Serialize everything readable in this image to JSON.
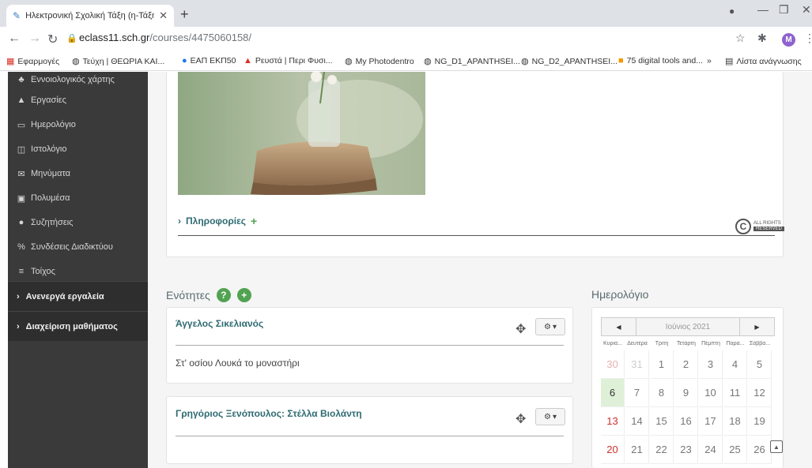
{
  "browser": {
    "tab_title": "Ηλεκτρονική Σχολική Τάξη (η-Τάξη)",
    "url_host": "eclass11.sch.gr",
    "url_path": "/courses/4475060158/",
    "avatar_letter": "M",
    "bookmarks": [
      {
        "label": "Εφαρμογές",
        "icon": "apps-grid-icon"
      },
      {
        "label": "Τεύχη | ΘΕΩΡΙΑ ΚΑΙ...",
        "icon": "globe-icon"
      },
      {
        "label": "ΕΑΠ ΕΚΠ50",
        "icon": "globe-icon"
      },
      {
        "label": "Ρευστά | Περι Φυσι...",
        "icon": "globe-icon"
      },
      {
        "label": "My Photodentro",
        "icon": "globe-icon"
      },
      {
        "label": "NG_D1_APANTHSEI...",
        "icon": "globe-icon"
      },
      {
        "label": "NG_D2_APANTHSEI...",
        "icon": "globe-icon"
      },
      {
        "label": "75 digital tools and...",
        "icon": "globe-icon"
      }
    ],
    "more_bookmarks": "»",
    "reading_list": "Λίστα ανάγνωσης"
  },
  "sidebar": {
    "items": [
      {
        "label": "Εννοιολογικός χάρτης",
        "icon": "sitemap-icon"
      },
      {
        "label": "Εργασίες",
        "icon": "flask-icon"
      },
      {
        "label": "Ημερολόγιο",
        "icon": "calendar-icon"
      },
      {
        "label": "Ιστολόγιο",
        "icon": "columns-icon"
      },
      {
        "label": "Μηνύματα",
        "icon": "envelope-icon"
      },
      {
        "label": "Πολυμέσα",
        "icon": "film-icon"
      },
      {
        "label": "Συζητήσεις",
        "icon": "comments-icon"
      },
      {
        "label": "Συνδέσεις Διαδικτύου",
        "icon": "link-icon"
      },
      {
        "label": "Τοίχος",
        "icon": "list-icon"
      }
    ],
    "sections": [
      {
        "label": "Ανενεργά εργαλεία"
      },
      {
        "label": "Διαχείριση μαθήματος"
      }
    ]
  },
  "course": {
    "info_label": "Πληροφορίες"
  },
  "units": {
    "heading": "Ενότητες",
    "help": "?",
    "add": "+",
    "list": [
      {
        "title": "Άγγελος Σικελιανός",
        "description": "Στ' οσίου Λουκά το μοναστήρι"
      },
      {
        "title": "Γρηγόριος Ξενόπουλος: Στέλλα Βιολάντη",
        "description": ""
      }
    ]
  },
  "calendar": {
    "heading": "Ημερολόγιο",
    "prev": "◀",
    "next": "▶",
    "month": "Ιούνιος 2021",
    "weekdays": [
      "Κυρια...",
      "Δευτέρα",
      "Τρίτη",
      "Τετάρτη",
      "Πέμπτη",
      "Παρα...",
      "Σάββα..."
    ],
    "weeks": [
      [
        "30",
        "31",
        "1",
        "2",
        "3",
        "4",
        "5"
      ],
      [
        "6",
        "7",
        "8",
        "9",
        "10",
        "11",
        "12"
      ],
      [
        "13",
        "14",
        "15",
        "16",
        "17",
        "18",
        "19"
      ],
      [
        "20",
        "21",
        "22",
        "23",
        "24",
        "25",
        "26"
      ]
    ],
    "today": "6"
  }
}
